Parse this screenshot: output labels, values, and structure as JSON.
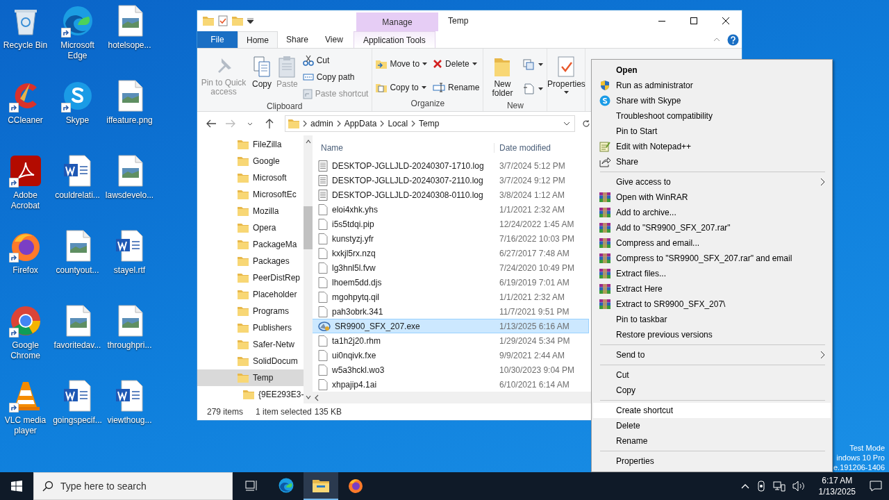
{
  "desktop_icons": [
    {
      "label": "Recycle Bin",
      "kind": "recycle",
      "shortcut": false
    },
    {
      "label": "Microsoft Edge",
      "kind": "edge",
      "shortcut": true
    },
    {
      "label": "hotelsope...",
      "kind": "image",
      "shortcut": false
    },
    {
      "label": "CCleaner",
      "kind": "ccleaner",
      "shortcut": true
    },
    {
      "label": "Skype",
      "kind": "skype",
      "shortcut": true
    },
    {
      "label": "iffeature.png",
      "kind": "image",
      "shortcut": false
    },
    {
      "label": "Adobe Acrobat",
      "kind": "acrobat",
      "shortcut": true
    },
    {
      "label": "couldrelati...",
      "kind": "word",
      "shortcut": false
    },
    {
      "label": "lawsdevelo...",
      "kind": "image",
      "shortcut": false
    },
    {
      "label": "Firefox",
      "kind": "firefox",
      "shortcut": true
    },
    {
      "label": "countyout...",
      "kind": "image",
      "shortcut": false
    },
    {
      "label": "stayel.rtf",
      "kind": "word",
      "shortcut": false
    },
    {
      "label": "Google Chrome",
      "kind": "chrome",
      "shortcut": true
    },
    {
      "label": "favoritedav...",
      "kind": "image",
      "shortcut": false
    },
    {
      "label": "throughpri...",
      "kind": "image",
      "shortcut": false
    },
    {
      "label": "VLC media player",
      "kind": "vlc",
      "shortcut": true
    },
    {
      "label": "goingspecif...",
      "kind": "word",
      "shortcut": false
    },
    {
      "label": "viewthoug...",
      "kind": "word",
      "shortcut": false
    }
  ],
  "explorer": {
    "title": "Temp",
    "context_label": "Manage",
    "tabs": [
      {
        "label": "File",
        "kind": "file",
        "selected": false
      },
      {
        "label": "Home",
        "kind": "normal",
        "selected": true
      },
      {
        "label": "Share",
        "kind": "normal",
        "selected": false
      },
      {
        "label": "View",
        "kind": "normal",
        "selected": false
      },
      {
        "label": "Application Tools",
        "kind": "contextual",
        "selected": false
      }
    ],
    "ribbon": [
      {
        "label": "Clipboard",
        "columns": [
          [
            {
              "label": "Pin to Quick access",
              "kind": "large",
              "disabled": true,
              "dropdown": false
            }
          ],
          [
            {
              "label": "Copy",
              "kind": "large",
              "disabled": false,
              "dropdown": false
            }
          ],
          [
            {
              "label": "Paste",
              "kind": "large",
              "disabled": true,
              "dropdown": false
            }
          ],
          [
            {
              "label": "Cut",
              "kind": "small",
              "disabled": false,
              "dropdown": false
            },
            {
              "label": "Copy path",
              "kind": "small",
              "disabled": false,
              "dropdown": false
            },
            {
              "label": "Paste shortcut",
              "kind": "small",
              "disabled": true,
              "dropdown": false
            }
          ]
        ]
      },
      {
        "label": "Organize",
        "columns": [
          [
            {
              "label": "Move to",
              "kind": "small",
              "disabled": false,
              "dropdown": true
            },
            {
              "label": "Copy to",
              "kind": "small",
              "disabled": false,
              "dropdown": true
            }
          ],
          [
            {
              "label": "Delete",
              "kind": "small",
              "disabled": false,
              "dropdown": true
            },
            {
              "label": "Rename",
              "kind": "small",
              "disabled": false,
              "dropdown": false
            }
          ]
        ]
      },
      {
        "label": "New",
        "columns": [
          [
            {
              "label": "New folder",
              "kind": "large",
              "disabled": false,
              "dropdown": false
            }
          ],
          [
            {
              "kind": "icon",
              "disabled": false,
              "dropdown": true
            },
            {
              "kind": "icon",
              "disabled": false,
              "dropdown": true
            }
          ]
        ]
      },
      {
        "columns": [
          [
            {
              "label": "Properties",
              "kind": "large",
              "disabled": false,
              "dropdown": true
            }
          ]
        ]
      }
    ],
    "address": [
      "admin",
      "AppData",
      "Local",
      "Temp"
    ],
    "nav": [
      {
        "label": "FileZilla",
        "selected": false
      },
      {
        "label": "Google",
        "selected": false
      },
      {
        "label": "Microsoft",
        "selected": false
      },
      {
        "label": "MicrosoftEc",
        "selected": false
      },
      {
        "label": "Mozilla",
        "selected": false
      },
      {
        "label": "Opera",
        "selected": false
      },
      {
        "label": "PackageMa",
        "selected": false
      },
      {
        "label": "Packages",
        "selected": false
      },
      {
        "label": "PeerDistRep",
        "selected": false
      },
      {
        "label": "Placeholder",
        "selected": false
      },
      {
        "label": "Programs",
        "selected": false
      },
      {
        "label": "Publishers",
        "selected": false
      },
      {
        "label": "Safer-Netw",
        "selected": false
      },
      {
        "label": "SolidDocum",
        "selected": false
      },
      {
        "label": "Temp",
        "selected": true,
        "children": [
          {
            "label": "{9EE293E3-",
            "selected": false
          }
        ]
      }
    ],
    "columns": [
      "Name",
      "Date modified"
    ],
    "rows": [
      {
        "name": "DESKTOP-JGLLJLD-20240307-1710.log",
        "date": "3/7/2024 5:12 PM",
        "kind": "log",
        "selected": false
      },
      {
        "name": "DESKTOP-JGLLJLD-20240307-2110.log",
        "date": "3/7/2024 9:12 PM",
        "kind": "log",
        "selected": false
      },
      {
        "name": "DESKTOP-JGLLJLD-20240308-0110.log",
        "date": "3/8/2024 1:12 AM",
        "kind": "log",
        "selected": false
      },
      {
        "name": "eloi4xhk.yhs",
        "date": "1/1/2021 2:32 AM",
        "kind": "file",
        "selected": false
      },
      {
        "name": "i5s5tdqi.pip",
        "date": "12/24/2022 1:45 AM",
        "kind": "file",
        "selected": false
      },
      {
        "name": "kunstyzj.yfr",
        "date": "7/16/2022 10:03 PM",
        "kind": "file",
        "selected": false
      },
      {
        "name": "kxkjl5rx.nzq",
        "date": "6/27/2017 7:48 AM",
        "kind": "file",
        "selected": false
      },
      {
        "name": "lg3hnl5l.fvw",
        "date": "7/24/2020 10:49 PM",
        "kind": "file",
        "selected": false
      },
      {
        "name": "lhoem5dd.djs",
        "date": "6/19/2019 7:01 AM",
        "kind": "file",
        "selected": false
      },
      {
        "name": "mgohpytq.qil",
        "date": "1/1/2021 2:32 AM",
        "kind": "file",
        "selected": false
      },
      {
        "name": "pah3obrk.341",
        "date": "11/7/2021 9:51 PM",
        "kind": "file",
        "selected": false
      },
      {
        "name": "SR9900_SFX_207.exe",
        "date": "1/13/2025 6:16 AM",
        "kind": "exe",
        "selected": true
      },
      {
        "name": "ta1h2j20.rhm",
        "date": "1/29/2024 5:34 PM",
        "kind": "file",
        "selected": false
      },
      {
        "name": "ui0nqivk.fxe",
        "date": "9/9/2021 2:44 AM",
        "kind": "file",
        "selected": false
      },
      {
        "name": "w5a3hckl.wo3",
        "date": "10/30/2023 9:04 PM",
        "kind": "file",
        "selected": false
      },
      {
        "name": "xhpajip4.1ai",
        "date": "6/10/2021 6:14 AM",
        "kind": "file",
        "selected": false
      }
    ],
    "status": {
      "count": "279 items",
      "selection": "1 item selected",
      "size": "135 KB"
    }
  },
  "context_menu": [
    {
      "label": "Open",
      "kind": "default",
      "selected": false
    },
    {
      "label": "Run as administrator",
      "kind": "admin",
      "selected": false
    },
    {
      "label": "Share with Skype",
      "kind": "skype",
      "selected": false
    },
    {
      "label": "Troubleshoot compatibility",
      "kind": "plain",
      "selected": false
    },
    {
      "label": "Pin to Start",
      "kind": "plain",
      "selected": false
    },
    {
      "label": "Edit with Notepad++",
      "kind": "notepad",
      "selected": false
    },
    {
      "label": "Share",
      "kind": "share",
      "selected": false
    },
    {
      "kind": "separator"
    },
    {
      "label": "Give access to",
      "kind": "submenu",
      "selected": false
    },
    {
      "label": "Open with WinRAR",
      "kind": "winrar",
      "selected": false
    },
    {
      "label": "Add to archive...",
      "kind": "winrar",
      "selected": false
    },
    {
      "label": "Add to \"SR9900_SFX_207.rar\"",
      "kind": "winrar",
      "selected": false
    },
    {
      "label": "Compress and email...",
      "kind": "winrar",
      "selected": false
    },
    {
      "label": "Compress to \"SR9900_SFX_207.rar\" and email",
      "kind": "winrar",
      "selected": false
    },
    {
      "label": "Extract files...",
      "kind": "winrar",
      "selected": false
    },
    {
      "label": "Extract Here",
      "kind": "winrar",
      "selected": false
    },
    {
      "label": "Extract to SR9900_SFX_207\\",
      "kind": "winrar",
      "selected": false
    },
    {
      "label": "Pin to taskbar",
      "kind": "plain",
      "selected": false
    },
    {
      "label": "Restore previous versions",
      "kind": "plain",
      "selected": false
    },
    {
      "kind": "separator"
    },
    {
      "label": "Send to",
      "kind": "submenu",
      "selected": false
    },
    {
      "kind": "separator"
    },
    {
      "label": "Cut",
      "kind": "plain",
      "selected": false
    },
    {
      "label": "Copy",
      "kind": "plain",
      "selected": false
    },
    {
      "kind": "separator"
    },
    {
      "label": "Create shortcut",
      "kind": "plain",
      "selected": true
    },
    {
      "label": "Delete",
      "kind": "plain",
      "selected": false
    },
    {
      "label": "Rename",
      "kind": "plain",
      "selected": false
    },
    {
      "kind": "separator"
    },
    {
      "label": "Properties",
      "kind": "plain",
      "selected": false
    }
  ],
  "os_notice": [
    "Test Mode",
    "indows 10 Pro",
    "e.191206-1406"
  ],
  "taskbar": {
    "search_placeholder": "Type here to search",
    "apps": [
      {
        "kind": "taskview",
        "selected": false
      },
      {
        "kind": "edge",
        "selected": false
      },
      {
        "kind": "explorer",
        "selected": true
      },
      {
        "kind": "firefox",
        "selected": false
      }
    ],
    "time": "6:17 AM",
    "date": "1/13/2025"
  }
}
